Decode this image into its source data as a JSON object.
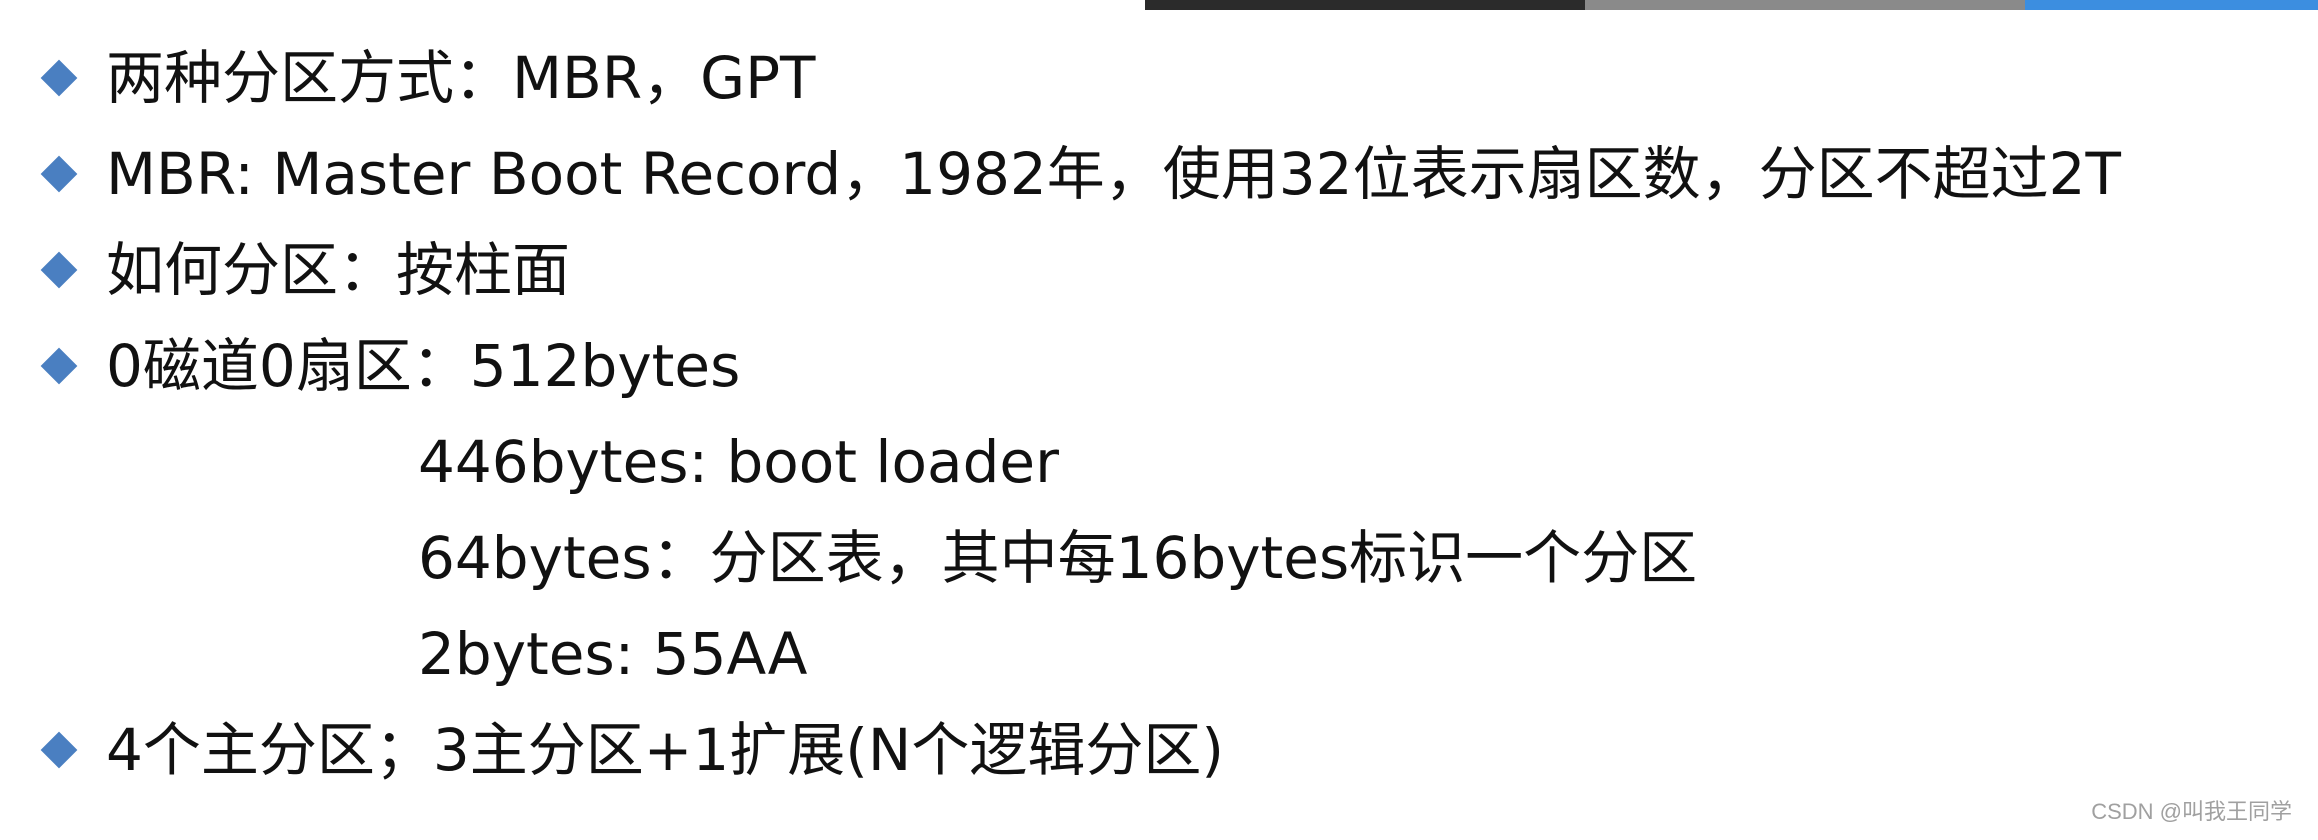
{
  "bullets": [
    {
      "text": "两种分区方式：MBR，GPT"
    },
    {
      "text": "MBR: Master Boot Record，1982年，使用32位表示扇区数，分区不超过2T"
    },
    {
      "text": "如何分区：按柱面"
    },
    {
      "text": "0磁道0扇区：512bytes"
    }
  ],
  "sublines": [
    {
      "text": "446bytes: boot loader"
    },
    {
      "text": "64bytes：分区表，其中每16bytes标识一个分区"
    },
    {
      "text": "2bytes: 55AA"
    }
  ],
  "last_bullet": {
    "text": "4个主分区；3主分区+1扩展(N个逻辑分区)"
  },
  "watermark": "CSDN @叫我王同学",
  "colors": {
    "bullet": "#4a7fc1",
    "top_bar_dark": "#2b2b2b",
    "top_bar_gray": "#8a8a8a",
    "top_bar_blue": "#3c8ee0"
  },
  "icons": {
    "bullet": "diamond-bullet-icon"
  }
}
